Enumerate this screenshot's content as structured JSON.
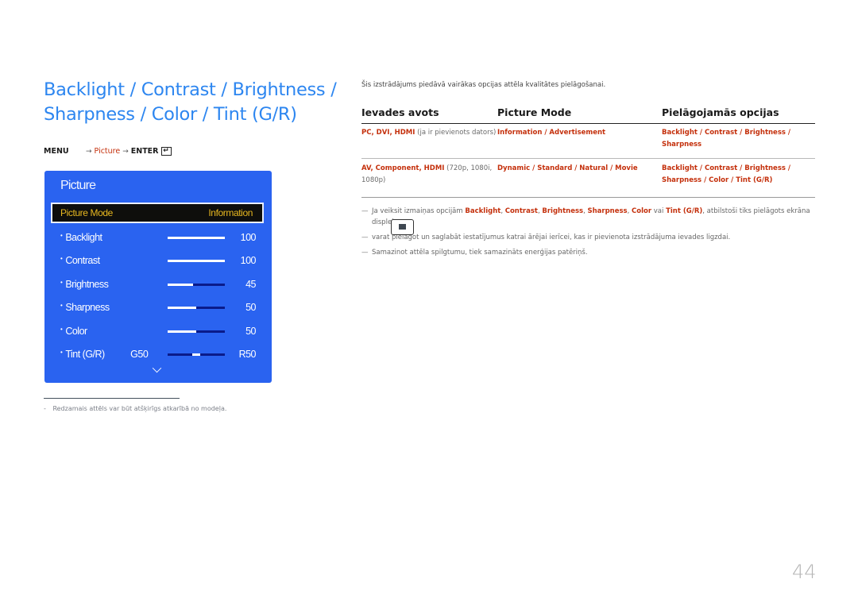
{
  "title": {
    "line1": "Backlight / Contrast / Brightness /",
    "line2": "Sharpness / Color / Tint (G/R)"
  },
  "menu_path": {
    "menu": "MENU",
    "arrow": "→",
    "picture": "Picture",
    "enter": "ENTER",
    "enter_icon": "enter-key-icon"
  },
  "osd": {
    "title": "Picture",
    "mode_label": "Picture Mode",
    "mode_value": "Information",
    "bullet": "•",
    "items": [
      {
        "label": "Backlight",
        "value": "100",
        "fraction": 1.0
      },
      {
        "label": "Contrast",
        "value": "100",
        "fraction": 1.0
      },
      {
        "label": "Brightness",
        "value": "45",
        "fraction": 0.45
      },
      {
        "label": "Sharpness",
        "value": "50",
        "fraction": 0.5
      },
      {
        "label": "Color",
        "value": "50",
        "fraction": 0.5
      }
    ],
    "tint": {
      "label": "Tint (G/R)",
      "left_value": "G50",
      "right_value": "R50",
      "position": 0.5
    },
    "more_icon": "chevron-down-icon"
  },
  "footnote": {
    "dash": "-",
    "text": "Redzamais attēls var būt atšķirīgs atkarībā no modeļa."
  },
  "intro": "Šis izstrādājums piedāvā vairākas opcijas attēla kvalitātes pielāgošanai.",
  "table": {
    "headers": [
      "Ievades avots",
      "Picture Mode",
      "Pielāgojamās opcijas"
    ],
    "rows": [
      {
        "source_red": "PC, DVI, HDMI",
        "source_gray": " (ja ir pievienots dators)",
        "modes": "Information / Advertisement",
        "options": "Backlight / Contrast / Brightness / Sharpness"
      },
      {
        "source_red": "AV, Component, HDMI",
        "source_gray": " (720p, 1080i, 1080p)",
        "modes": "Dynamic / Standard / Natural / Movie",
        "options": "Backlight / Contrast / Brightness / Sharpness / Color / Tint (G/R)"
      }
    ]
  },
  "notes": [
    {
      "dash": "—",
      "pre": "Ja veiksit izmaiņas opcijām ",
      "b1": "Backlight",
      "s1": ", ",
      "b2": "Contrast",
      "s2": ", ",
      "b3": "Brightness",
      "s3": ", ",
      "b4": "Sharpness",
      "s4": ", ",
      "b5": "Color",
      "s5": " vai ",
      "b6": "Tint (G/R)",
      "post": ", atbilstoši tiks pielāgots ekrāna displejs."
    },
    {
      "dash": "—",
      "text": "varat pielāgot un saglabāt iestatījumus katrai ārējai ierīcei, kas ir pievienota izstrādājuma ievades ligzdai."
    },
    {
      "dash": "—",
      "text": "Samazinot attēla spilgtumu, tiek samazināts enerģijas patēriņš."
    }
  ],
  "display_icon": "display-icon",
  "page_number": "44"
}
